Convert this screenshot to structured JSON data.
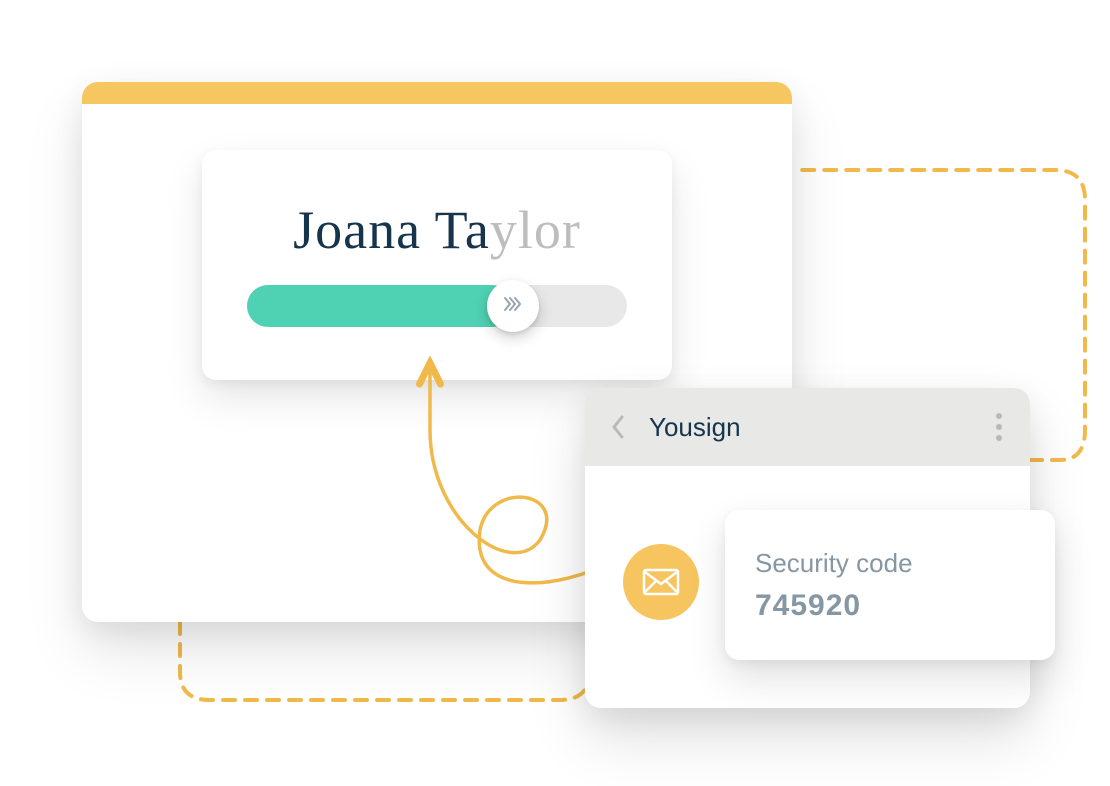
{
  "signature": {
    "text_dark": "Joana Ta",
    "text_light": "ylor",
    "slider_progress_pct": 70
  },
  "notification": {
    "app_name": "Yousign",
    "code_label": "Security code",
    "code_value": "745920"
  },
  "colors": {
    "accent_yellow": "#f6c760",
    "accent_teal": "#4fd1b3",
    "text_dark": "#16344c",
    "text_muted": "#8596a4"
  }
}
